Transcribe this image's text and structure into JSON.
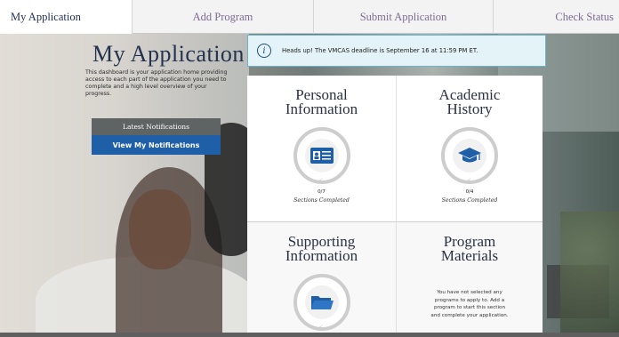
{
  "tabs": [
    {
      "label": "My Application",
      "active": true
    },
    {
      "label": "Add Program",
      "active": false
    },
    {
      "label": "Submit Application",
      "active": false
    },
    {
      "label": "Check Status",
      "active": false
    }
  ],
  "intro": {
    "title": "My Application",
    "description": "This dashboard is your application home providing access to each part of the application you need to complete and a high level overview of your progress."
  },
  "notifications": {
    "header": "Latest Notifications",
    "button_label": "View My Notifications"
  },
  "alert": {
    "icon": "info-icon",
    "text": "Heads up! The VMCAS deadline is September 16 at 11:59 PM ET."
  },
  "cards": [
    {
      "title": "Personal Information",
      "icon": "id-card-icon",
      "count": "0/7",
      "caption": "Sections Completed"
    },
    {
      "title": "Academic History",
      "icon": "graduation-cap-icon",
      "count": "0/4",
      "caption": "Sections Completed"
    },
    {
      "title": "Supporting Information",
      "icon": "folder-icon"
    },
    {
      "title": "Program Materials",
      "message": "You have not selected any programs to apply to. Add a program to start this section and complete your application."
    }
  ],
  "colors": {
    "accent_blue": "#1f5fa8",
    "title_navy": "#23324f",
    "tab_text": "#7e6a96",
    "alert_bg": "#e3f3f8",
    "alert_border": "#6bb5cc"
  }
}
